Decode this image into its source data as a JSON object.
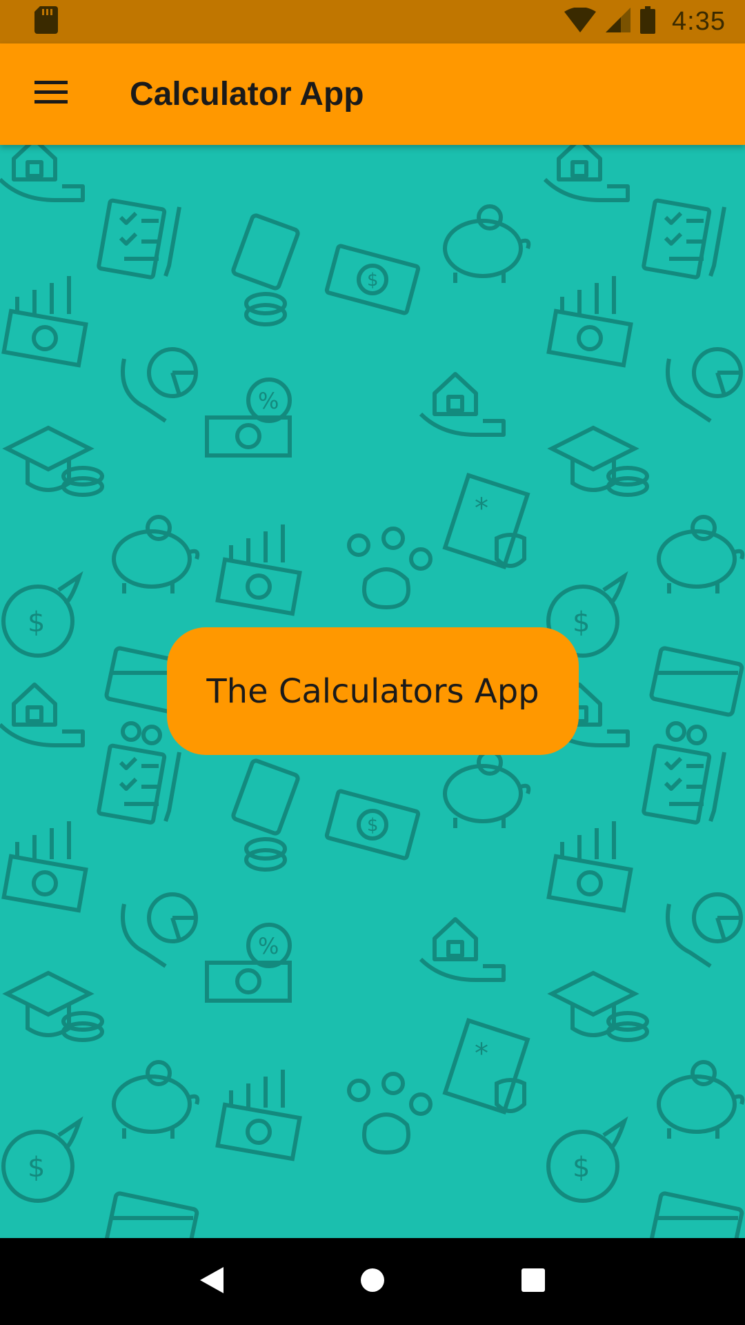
{
  "status_bar": {
    "time": "4:35",
    "icons": [
      "sd-card-icon",
      "wifi-icon",
      "signal-icon",
      "battery-icon"
    ]
  },
  "app_bar": {
    "title": "Calculator App",
    "menu_icon": "menu-icon"
  },
  "main": {
    "button_label": "The Calculators App",
    "background_pattern": "finance-icons-pattern"
  },
  "nav_bar": {
    "icons": [
      "back-icon",
      "home-icon",
      "recents-icon"
    ]
  },
  "colors": {
    "status_bar": "#c07600",
    "app_bar": "#ff9800",
    "background": "#1bbfae",
    "pattern_ink": "#138a7e",
    "button": "#ff9800",
    "nav_bar": "#000000"
  }
}
